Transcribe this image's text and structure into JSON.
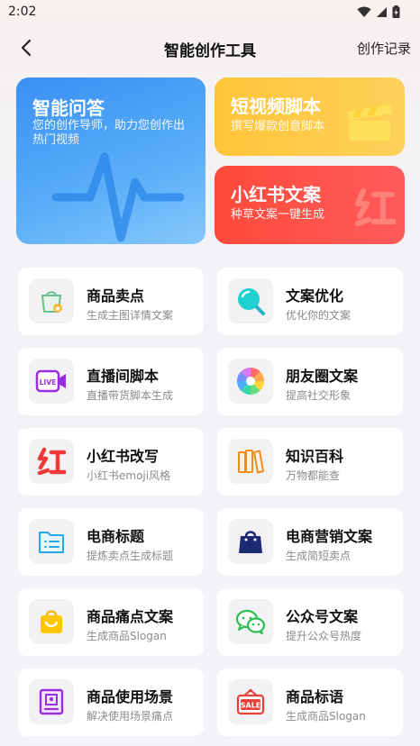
{
  "status": {
    "time": "2:02"
  },
  "header": {
    "title": "智能创作工具",
    "records": "创作记录"
  },
  "cards": {
    "qa": {
      "title": "智能问答",
      "subtitle": "您的创作导师，助力您创作出热门视频"
    },
    "video": {
      "title": "短视频脚本",
      "subtitle": "撰写爆款创意脚本"
    },
    "xhs": {
      "title": "小红书文案",
      "subtitle": "种草文案一键生成"
    }
  },
  "tools": [
    {
      "title": "商品卖点",
      "subtitle": "生成主图详情文案",
      "icon": "shopping-bag-icon"
    },
    {
      "title": "文案优化",
      "subtitle": "优化你的文案",
      "icon": "magnifier-icon"
    },
    {
      "title": "直播间脚本",
      "subtitle": "直播带货脚本生成",
      "icon": "live-camera-icon"
    },
    {
      "title": "朋友圈文案",
      "subtitle": "提高社交形象",
      "icon": "aperture-icon"
    },
    {
      "title": "小红书改写",
      "subtitle": "小红书emoji风格",
      "icon": "hong-char-icon"
    },
    {
      "title": "知识百科",
      "subtitle": "万物都能查",
      "icon": "books-icon"
    },
    {
      "title": "电商标题",
      "subtitle": "提炼卖点生成标题",
      "icon": "folder-list-icon"
    },
    {
      "title": "电商营销文案",
      "subtitle": "生成简短卖点",
      "icon": "dark-bag-icon"
    },
    {
      "title": "商品痛点文案",
      "subtitle": "生成商品Slogan",
      "icon": "smile-bag-icon"
    },
    {
      "title": "公众号文案",
      "subtitle": "提升公众号热度",
      "icon": "wechat-icon"
    },
    {
      "title": "商品使用场景",
      "subtitle": "解决使用场景痛点",
      "icon": "picture-frame-icon"
    },
    {
      "title": "商品标语",
      "subtitle": "生成商品Slogan",
      "icon": "sale-tag-icon"
    }
  ],
  "colors": {
    "qa_card": "#3a8ff5",
    "video_card": "#ffc43a",
    "xhs_card": "#ff4a3a"
  }
}
